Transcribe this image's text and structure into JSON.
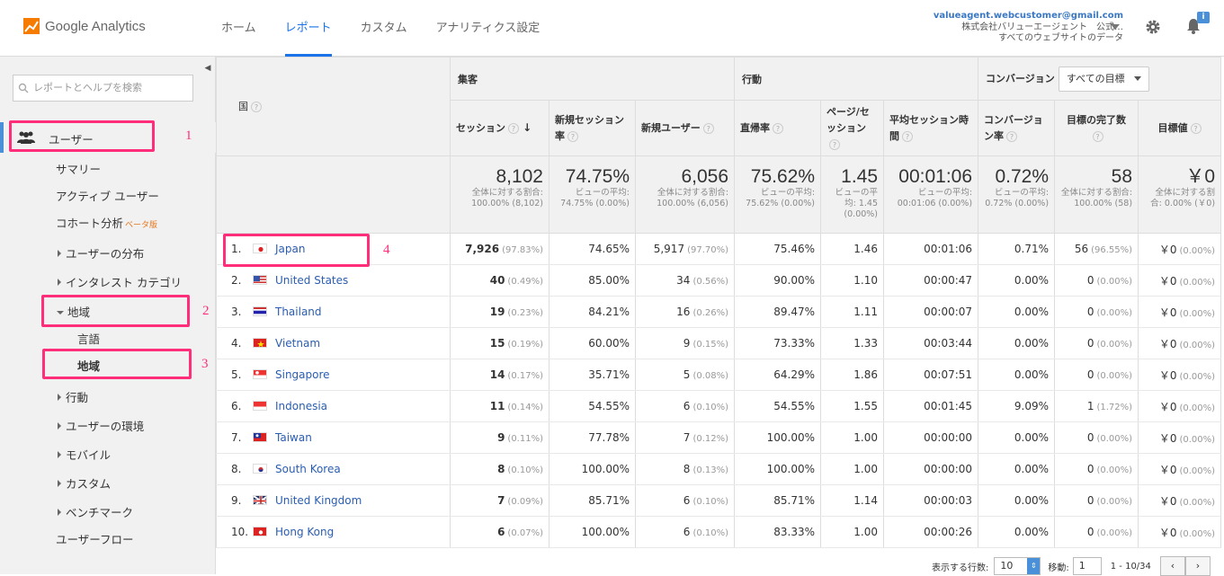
{
  "header": {
    "app_name": "Google Analytics",
    "tabs": [
      "ホーム",
      "レポート",
      "カスタム",
      "アナリティクス設定"
    ],
    "active_tab": "レポート",
    "account_email": "valueagent.webcustomer@gmail.com",
    "account_name": "株式会社バリューエージェント　公式…",
    "account_view": "すべてのウェブサイトのデータ",
    "notification_badge": "i"
  },
  "sidebar": {
    "search_placeholder": "レポートとヘルプを検索",
    "users_label": "ユーザー",
    "items": {
      "summary": "サマリー",
      "active_users": "アクティブ ユーザー",
      "cohort": "コホート分析",
      "cohort_badge": "ベータ版",
      "demographics": "ユーザーの分布",
      "interests": "インタレスト カテゴリ",
      "geo": "地域",
      "language": "言語",
      "location": "地域",
      "behavior": "行動",
      "technology": "ユーザーの環境",
      "mobile": "モバイル",
      "custom": "カスタム",
      "benchmark": "ベンチマーク",
      "user_flow": "ユーザーフロー"
    },
    "steps": [
      "1",
      "2",
      "3"
    ]
  },
  "table": {
    "dimension_label": "国",
    "groups": {
      "acquisition": "集客",
      "behavior": "行動",
      "conversion": "コンバージョン",
      "goal_select": "すべての目標"
    },
    "columns": [
      "セッション",
      "新規セッション率",
      "新規ユーザー",
      "直帰率",
      "ページ/セッション",
      "平均セッション時間",
      "コンバージョン率",
      "目標の完了数",
      "目標値"
    ],
    "totals": [
      {
        "big": "8,102",
        "small": "全体に対する割合: 100.00% (8,102)"
      },
      {
        "big": "74.75%",
        "small": "ビューの平均: 74.75% (0.00%)"
      },
      {
        "big": "6,056",
        "small": "全体に対する割合: 100.00% (6,056)"
      },
      {
        "big": "75.62%",
        "small": "ビューの平均: 75.62% (0.00%)"
      },
      {
        "big": "1.45",
        "small": "ビューの平均: 1.45 (0.00%)"
      },
      {
        "big": "00:01:06",
        "small": "ビューの平均: 00:01:06 (0.00%)"
      },
      {
        "big": "0.72%",
        "small": "ビューの平均: 0.72% (0.00%)"
      },
      {
        "big": "58",
        "small": "全体に対する割合: 100.00% (58)"
      },
      {
        "big": "￥0",
        "small": "全体に対する割合: 0.00% (￥0)"
      }
    ],
    "rows": [
      {
        "n": "1.",
        "country": "Japan",
        "flag": "jp",
        "sessions": "7,926",
        "sessions_pct": "(97.83%)",
        "new_rate": "74.65%",
        "new_users": "5,917",
        "new_users_pct": "(97.70%)",
        "bounce": "75.46%",
        "pps": "1.46",
        "dur": "00:01:06",
        "conv": "0.71%",
        "goals": "56",
        "goals_pct": "(96.55%)",
        "value": "￥0",
        "value_pct": "(0.00%)"
      },
      {
        "n": "2.",
        "country": "United States",
        "flag": "us",
        "sessions": "40",
        "sessions_pct": "(0.49%)",
        "new_rate": "85.00%",
        "new_users": "34",
        "new_users_pct": "(0.56%)",
        "bounce": "90.00%",
        "pps": "1.10",
        "dur": "00:00:47",
        "conv": "0.00%",
        "goals": "0",
        "goals_pct": "(0.00%)",
        "value": "￥0",
        "value_pct": "(0.00%)"
      },
      {
        "n": "3.",
        "country": "Thailand",
        "flag": "th",
        "sessions": "19",
        "sessions_pct": "(0.23%)",
        "new_rate": "84.21%",
        "new_users": "16",
        "new_users_pct": "(0.26%)",
        "bounce": "89.47%",
        "pps": "1.11",
        "dur": "00:00:07",
        "conv": "0.00%",
        "goals": "0",
        "goals_pct": "(0.00%)",
        "value": "￥0",
        "value_pct": "(0.00%)"
      },
      {
        "n": "4.",
        "country": "Vietnam",
        "flag": "vn",
        "sessions": "15",
        "sessions_pct": "(0.19%)",
        "new_rate": "60.00%",
        "new_users": "9",
        "new_users_pct": "(0.15%)",
        "bounce": "73.33%",
        "pps": "1.33",
        "dur": "00:03:44",
        "conv": "0.00%",
        "goals": "0",
        "goals_pct": "(0.00%)",
        "value": "￥0",
        "value_pct": "(0.00%)"
      },
      {
        "n": "5.",
        "country": "Singapore",
        "flag": "sg",
        "sessions": "14",
        "sessions_pct": "(0.17%)",
        "new_rate": "35.71%",
        "new_users": "5",
        "new_users_pct": "(0.08%)",
        "bounce": "64.29%",
        "pps": "1.86",
        "dur": "00:07:51",
        "conv": "0.00%",
        "goals": "0",
        "goals_pct": "(0.00%)",
        "value": "￥0",
        "value_pct": "(0.00%)"
      },
      {
        "n": "6.",
        "country": "Indonesia",
        "flag": "id",
        "sessions": "11",
        "sessions_pct": "(0.14%)",
        "new_rate": "54.55%",
        "new_users": "6",
        "new_users_pct": "(0.10%)",
        "bounce": "54.55%",
        "pps": "1.55",
        "dur": "00:01:45",
        "conv": "9.09%",
        "goals": "1",
        "goals_pct": "(1.72%)",
        "value": "￥0",
        "value_pct": "(0.00%)"
      },
      {
        "n": "7.",
        "country": "Taiwan",
        "flag": "tw",
        "sessions": "9",
        "sessions_pct": "(0.11%)",
        "new_rate": "77.78%",
        "new_users": "7",
        "new_users_pct": "(0.12%)",
        "bounce": "100.00%",
        "pps": "1.00",
        "dur": "00:00:00",
        "conv": "0.00%",
        "goals": "0",
        "goals_pct": "(0.00%)",
        "value": "￥0",
        "value_pct": "(0.00%)"
      },
      {
        "n": "8.",
        "country": "South Korea",
        "flag": "kr",
        "sessions": "8",
        "sessions_pct": "(0.10%)",
        "new_rate": "100.00%",
        "new_users": "8",
        "new_users_pct": "(0.13%)",
        "bounce": "100.00%",
        "pps": "1.00",
        "dur": "00:00:00",
        "conv": "0.00%",
        "goals": "0",
        "goals_pct": "(0.00%)",
        "value": "￥0",
        "value_pct": "(0.00%)"
      },
      {
        "n": "9.",
        "country": "United Kingdom",
        "flag": "gb",
        "sessions": "7",
        "sessions_pct": "(0.09%)",
        "new_rate": "85.71%",
        "new_users": "6",
        "new_users_pct": "(0.10%)",
        "bounce": "85.71%",
        "pps": "1.14",
        "dur": "00:00:03",
        "conv": "0.00%",
        "goals": "0",
        "goals_pct": "(0.00%)",
        "value": "￥0",
        "value_pct": "(0.00%)"
      },
      {
        "n": "10.",
        "country": "Hong Kong",
        "flag": "hk",
        "sessions": "6",
        "sessions_pct": "(0.07%)",
        "new_rate": "100.00%",
        "new_users": "6",
        "new_users_pct": "(0.10%)",
        "bounce": "83.33%",
        "pps": "1.00",
        "dur": "00:00:26",
        "conv": "0.00%",
        "goals": "0",
        "goals_pct": "(0.00%)",
        "value": "￥0",
        "value_pct": "(0.00%)"
      }
    ],
    "step4": "4"
  },
  "pager": {
    "rows_label": "表示する行数:",
    "rows_value": "10",
    "goto_label": "移動:",
    "goto_value": "1",
    "range": "1 - 10/34",
    "prev": "‹",
    "next": "›"
  },
  "colors": {
    "accent": "#1a73e8",
    "highlight": "#ff2d7a",
    "link": "#2a5db0"
  }
}
